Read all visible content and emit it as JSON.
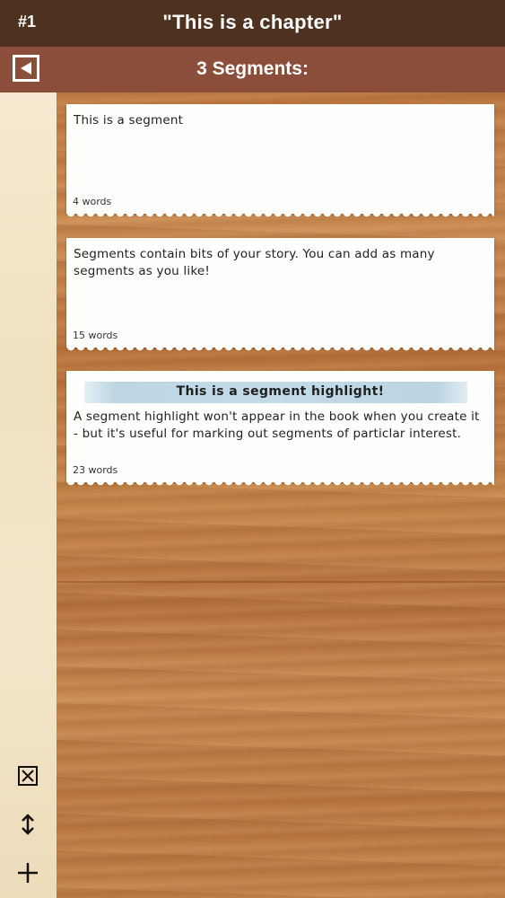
{
  "header": {
    "chapter_number": "#1",
    "chapter_title": "\"This is a chapter\""
  },
  "subheader": {
    "segments_label": "3 Segments:"
  },
  "segments": [
    {
      "text": "This is a segment",
      "word_count": "4 words"
    },
    {
      "text": "Segments contain bits of your story. You can add as many segments as you like!",
      "word_count": "15 words"
    },
    {
      "highlight": "This is a segment highlight!",
      "text": "A segment highlight won't appear in the book when you create it - but it's useful for marking out segments of particlar interest.",
      "word_count": "23 words"
    }
  ],
  "tools": [
    "delete-icon",
    "reorder-icon",
    "add-icon"
  ]
}
